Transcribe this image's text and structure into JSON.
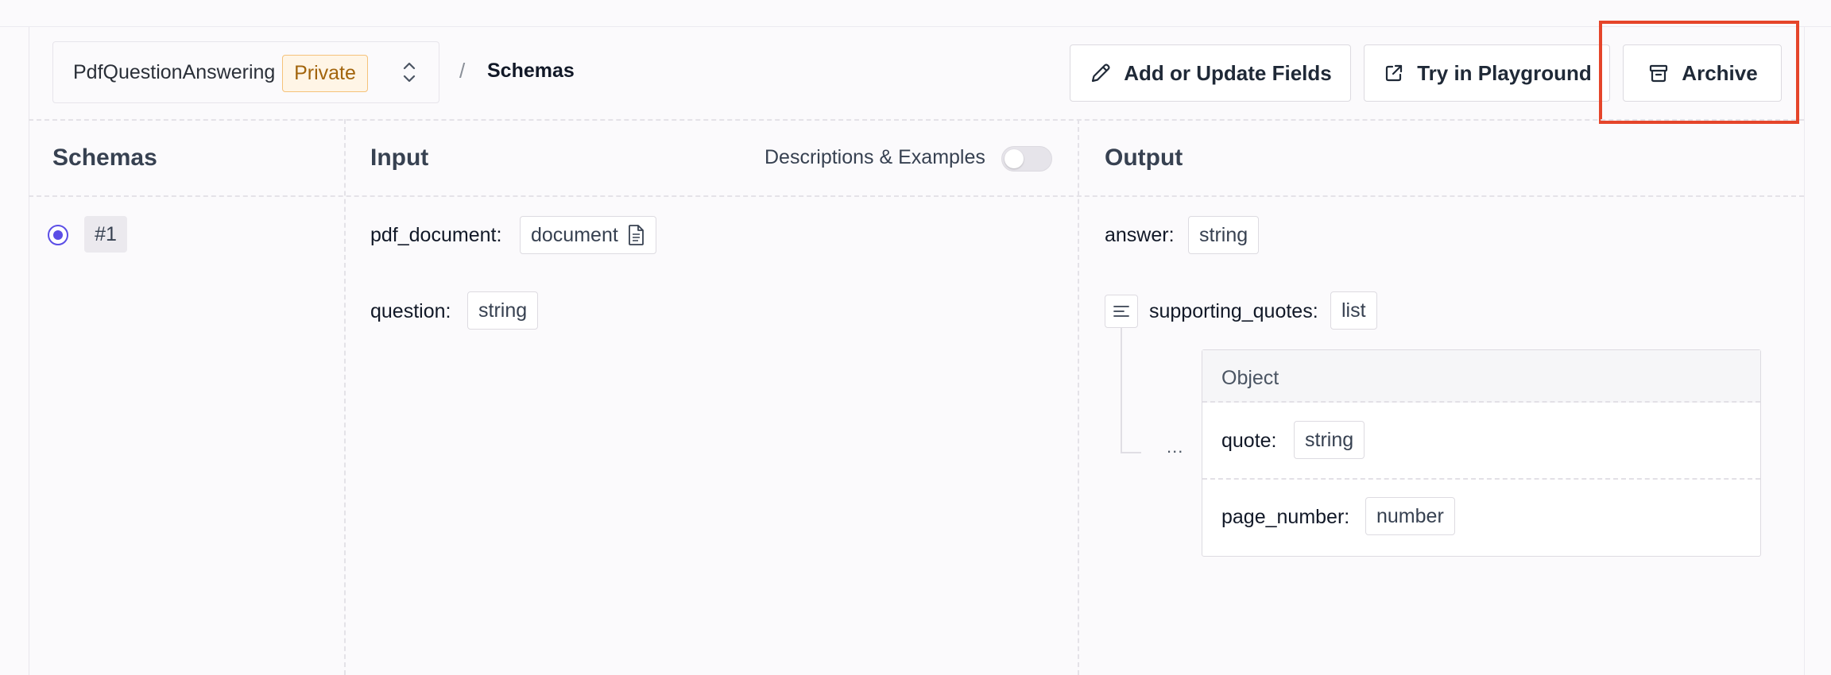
{
  "header": {
    "project_name": "PdfQuestionAnswering",
    "visibility_badge": "Private",
    "breadcrumb_separator": "/",
    "breadcrumb_current": "Schemas",
    "buttons": {
      "add_fields": "Add or Update Fields",
      "playground": "Try in Playground",
      "archive": "Archive"
    }
  },
  "schemas_panel": {
    "title": "Schemas",
    "items": [
      {
        "label": "#1",
        "selected": true
      }
    ]
  },
  "input_panel": {
    "title": "Input",
    "toggle_label": "Descriptions & Examples",
    "toggle_on": false,
    "fields": [
      {
        "name": "pdf_document:",
        "type": "document",
        "icon": "document-icon"
      },
      {
        "name": "question:",
        "type": "string"
      }
    ]
  },
  "output_panel": {
    "title": "Output",
    "fields": [
      {
        "name": "answer:",
        "type": "string"
      },
      {
        "name": "supporting_quotes:",
        "type": "list",
        "icon": "list-icon"
      }
    ],
    "list_item_marker": "...",
    "object": {
      "title": "Object",
      "fields": [
        {
          "name": "quote:",
          "type": "string"
        },
        {
          "name": "page_number:",
          "type": "number"
        }
      ]
    }
  },
  "colors": {
    "accent": "#5b4ee6",
    "highlight": "#e5452a",
    "badge_text": "#a2640c",
    "badge_bg": "#fff5e6"
  }
}
